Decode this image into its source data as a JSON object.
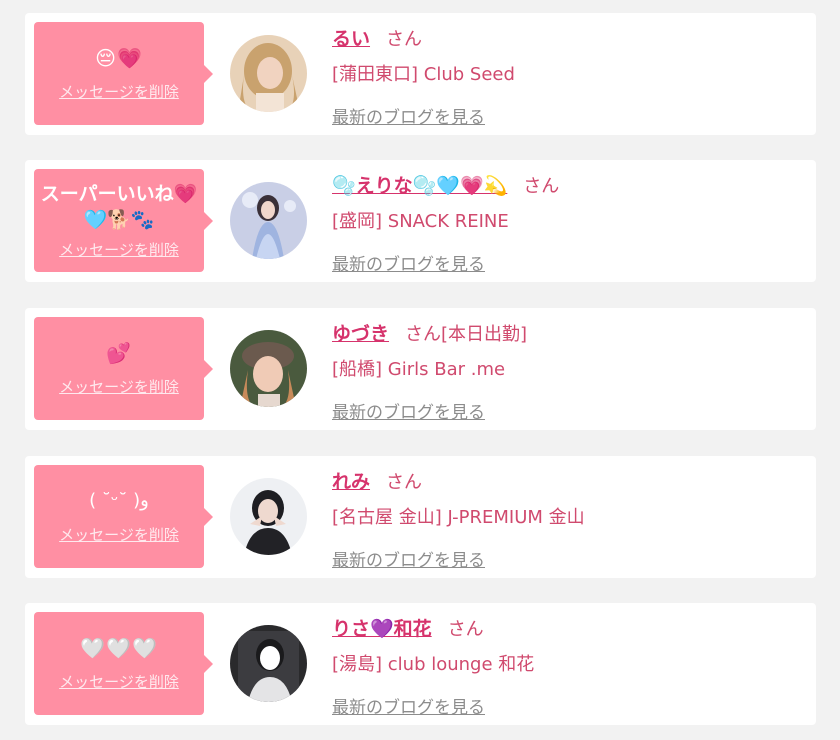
{
  "items": [
    {
      "message": "😔💗",
      "delete_label": "メッセージを削除",
      "name": "るい",
      "honorific": "さん",
      "tag": "",
      "shop": "[蒲田東口] Club Seed",
      "blog_label": "最新のブログを見る",
      "avatar": "avatar-blonde"
    },
    {
      "message": "スーパーいいね💗🩵🐕🐾",
      "delete_label": "メッセージを削除",
      "name": "🫧えりな🫧🩵💗💫",
      "honorific": "さん",
      "tag": "",
      "shop": "[盛岡] SNACK REINE",
      "blog_label": "最新のブログを見る",
      "avatar": "avatar-dress"
    },
    {
      "message": "💕",
      "delete_label": "メッセージを削除",
      "name": "ゆづき",
      "honorific": "さん",
      "tag": "[本日出勤]",
      "shop": "[船橋] Girls Bar .me",
      "blog_label": "最新のブログを見る",
      "avatar": "avatar-hat"
    },
    {
      "message": "( ˘ᵕ˘ )و",
      "delete_label": "メッセージを削除",
      "name": "れみ",
      "honorific": "さん",
      "tag": "",
      "shop": "[名古屋 金山] J-PREMIUM 金山",
      "blog_label": "最新のブログを見る",
      "avatar": "avatar-dark-hair"
    },
    {
      "message": "🤍🤍🤍",
      "delete_label": "メッセージを削除",
      "name": "りさ💜和花",
      "honorific": "さん",
      "tag": "",
      "shop": "[湯島] club lounge 和花",
      "blog_label": "最新のブログを見る",
      "avatar": "avatar-mirror"
    }
  ],
  "colors": {
    "bubble": "#ff8fa3",
    "name": "#d6336c",
    "text": "#d04a6e",
    "link": "#8c8c8c",
    "background": "#f2f2f2"
  }
}
